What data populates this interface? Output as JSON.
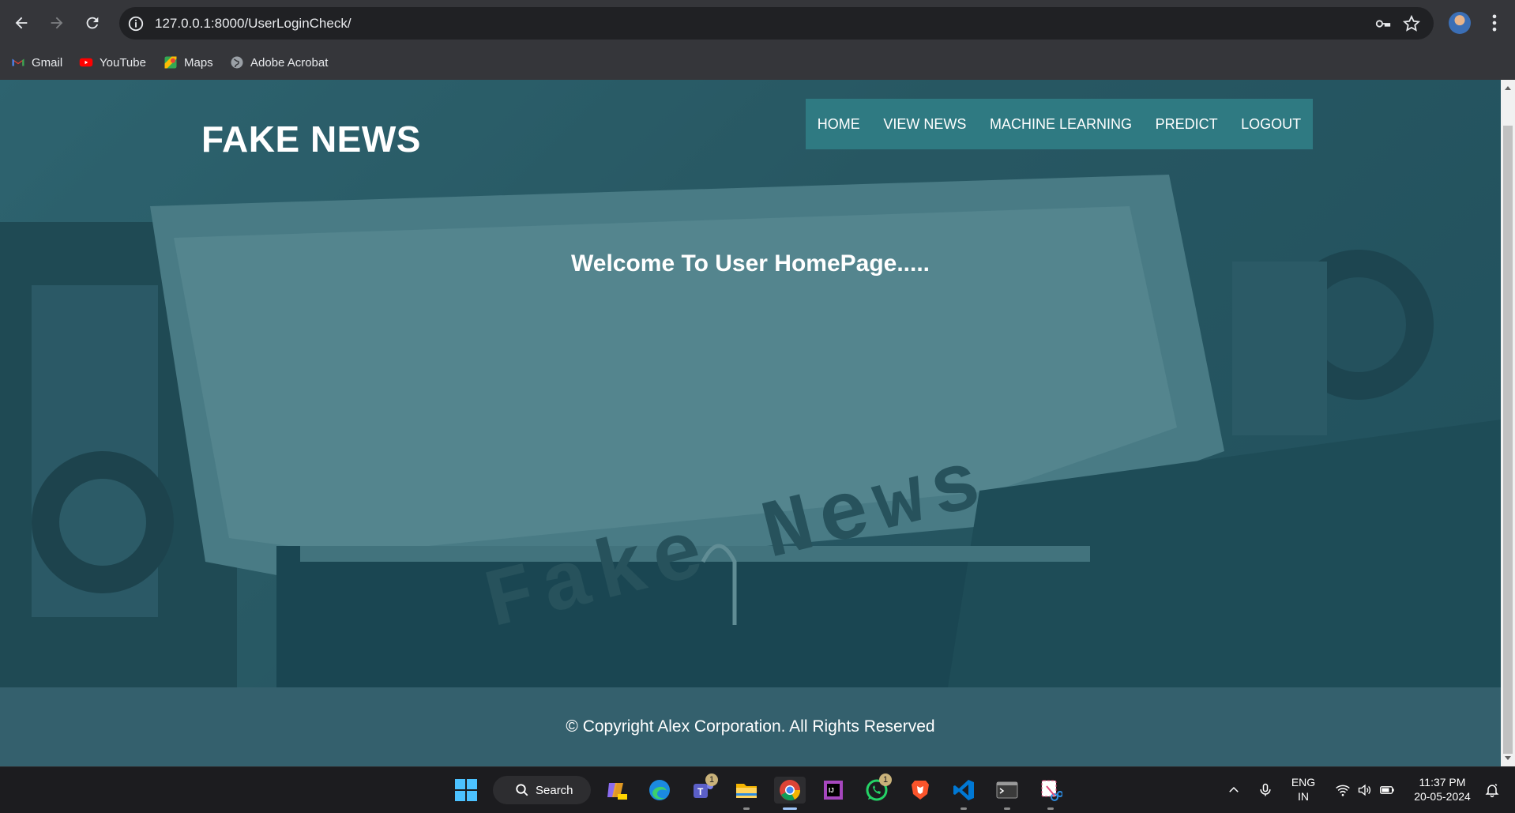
{
  "browser": {
    "url": "127.0.0.1:8000/UserLoginCheck/",
    "bookmarks": [
      "Gmail",
      "YouTube",
      "Maps",
      "Adobe Acrobat"
    ]
  },
  "site": {
    "logo": "FAKE NEWS",
    "nav": [
      "HOME",
      "VIEW NEWS",
      "MACHINE LEARNING",
      "PREDICT",
      "LOGOUT"
    ],
    "welcome": "Welcome To User HomePage.....",
    "hero_text": "Fake News",
    "footer": "© Copyright Alex Corporation. All Rights Reserved"
  },
  "taskbar": {
    "search_label": "Search",
    "teams_badge": "1",
    "whatsapp_badge": "1",
    "lang_line1": "ENG",
    "lang_line2": "IN",
    "time": "11:37 PM",
    "date": "20-05-2024"
  },
  "colors": {
    "hero_tint": "#2a5f6a",
    "nav_bg": "#2f7a82",
    "footer_bg": "#34606d"
  }
}
